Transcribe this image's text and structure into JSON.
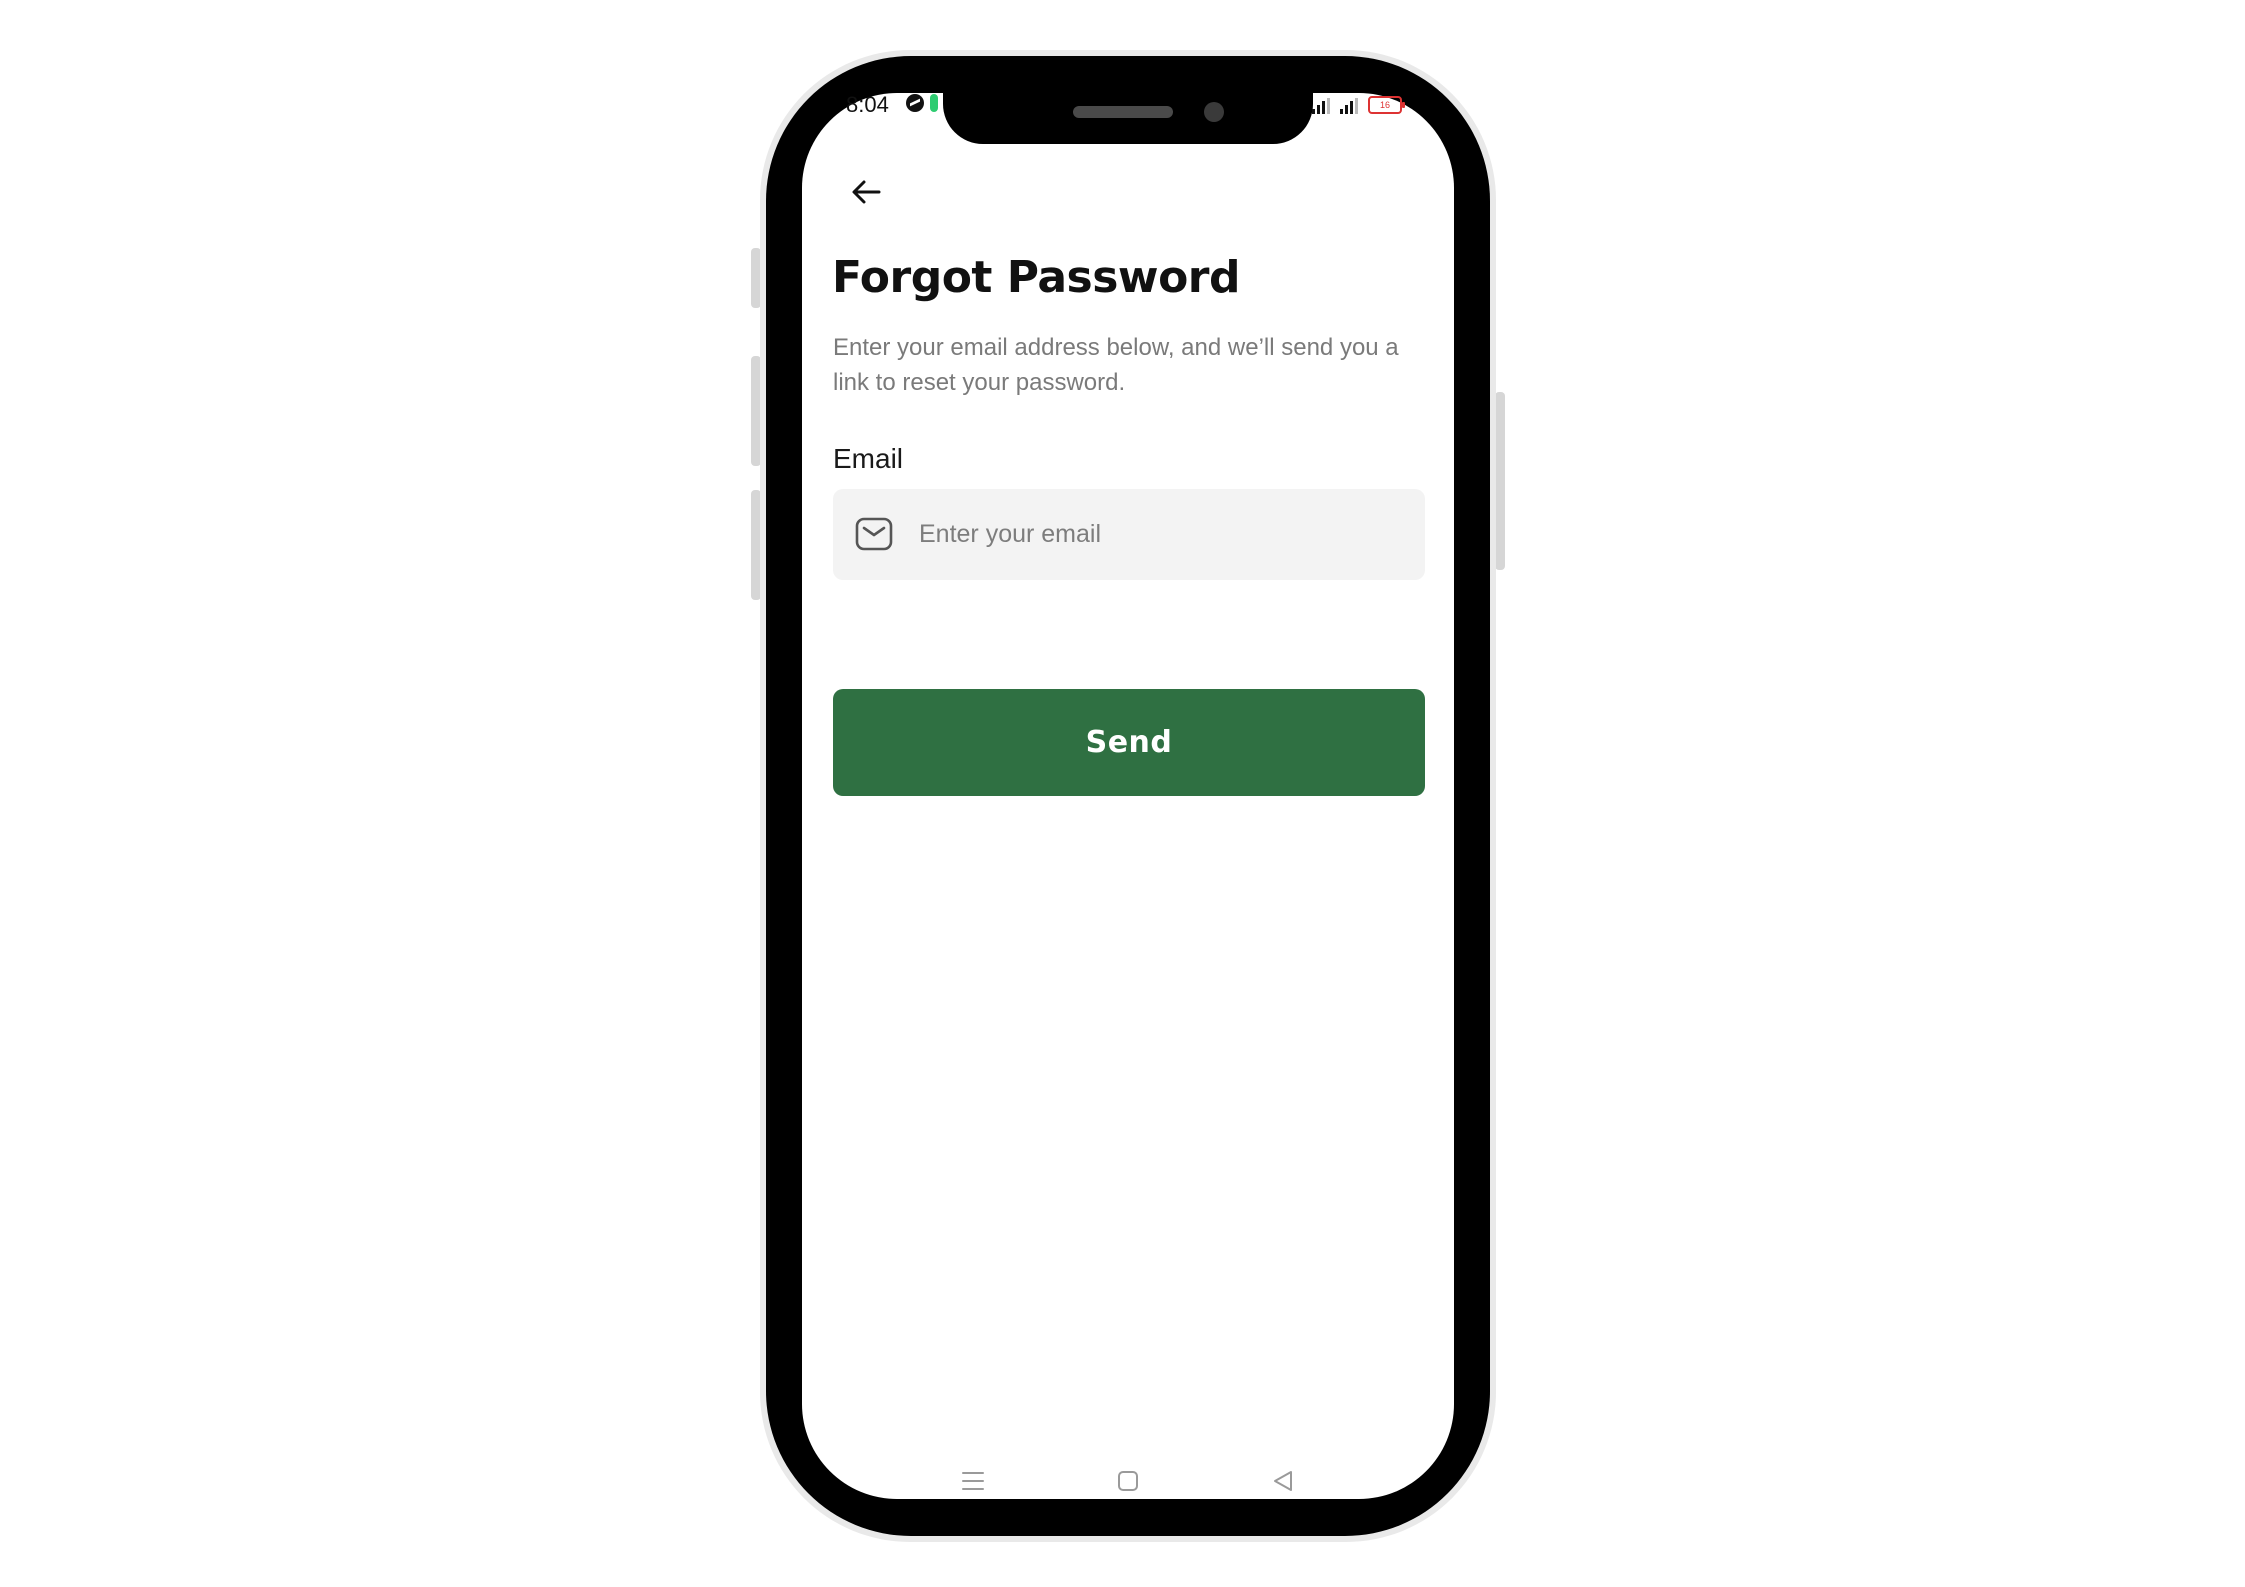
{
  "status_bar": {
    "time": "8:04",
    "battery_level": "16"
  },
  "screen": {
    "title": "Forgot Password",
    "subtitle": "Enter your email address below, and we’ll send you a link to reset your password.",
    "email_label": "Email",
    "email_placeholder": "Enter your email",
    "email_value": "",
    "send_label": "Send"
  },
  "icons": {
    "back": "arrow-left-icon",
    "email": "mail-icon",
    "nav_menu": "menu-icon",
    "nav_home": "square-icon",
    "nav_back": "triangle-back-icon"
  },
  "colors": {
    "primary": "#2f7042",
    "input_bg": "#f3f3f3",
    "subtitle": "#7a7a7a",
    "battery": "#d33333"
  }
}
